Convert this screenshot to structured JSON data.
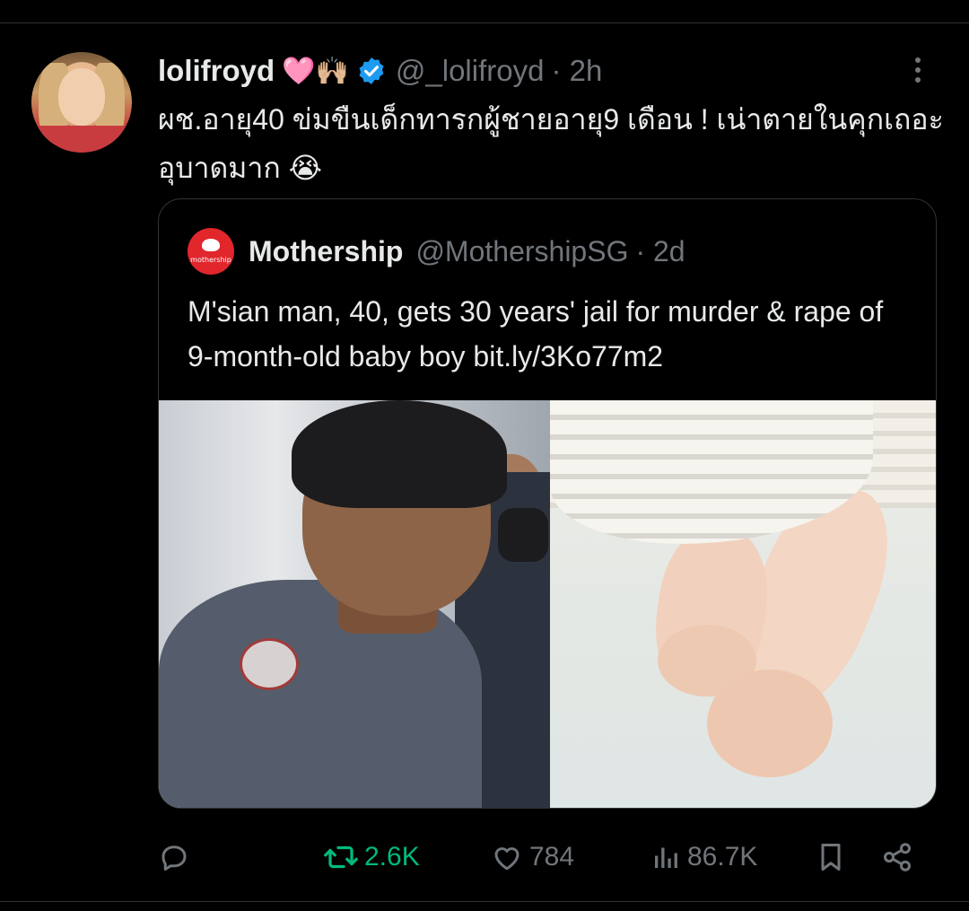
{
  "tweet": {
    "author": {
      "display_name": "lolifroyd",
      "name_emoji": "🩷🙌🏼",
      "handle": "@_lolifroyd",
      "time": "· 2h"
    },
    "text": "ผช.อายุ40 ข่มขืนเด็กทารกผู้ชายอายุ9 เดือน ! เน่าตายในคุกเถอะ อุบาดมาก 😭",
    "quote": {
      "author_name": "Mothership",
      "author_handle": "@MothershipSG",
      "time": "· 2d",
      "logo_text": "mothership",
      "text": "M'sian man, 40, gets 30 years' jail for murder & rape of 9-month-old baby boy bit.ly/3Ko77m2"
    },
    "actions": {
      "retweets": "2.6K",
      "likes": "784",
      "views": "86.7K"
    }
  },
  "colors": {
    "background": "#000000",
    "text": "#e7e9ea",
    "muted": "#71767b",
    "border": "#2f3336",
    "verified": "#1d9bf0",
    "retweet_active": "#00ba7c",
    "mothership_red": "#e1262c"
  },
  "icons": [
    "more-icon",
    "verified-badge-icon",
    "reply-icon",
    "retweet-icon",
    "like-icon",
    "views-icon",
    "bookmark-icon",
    "share-icon"
  ]
}
